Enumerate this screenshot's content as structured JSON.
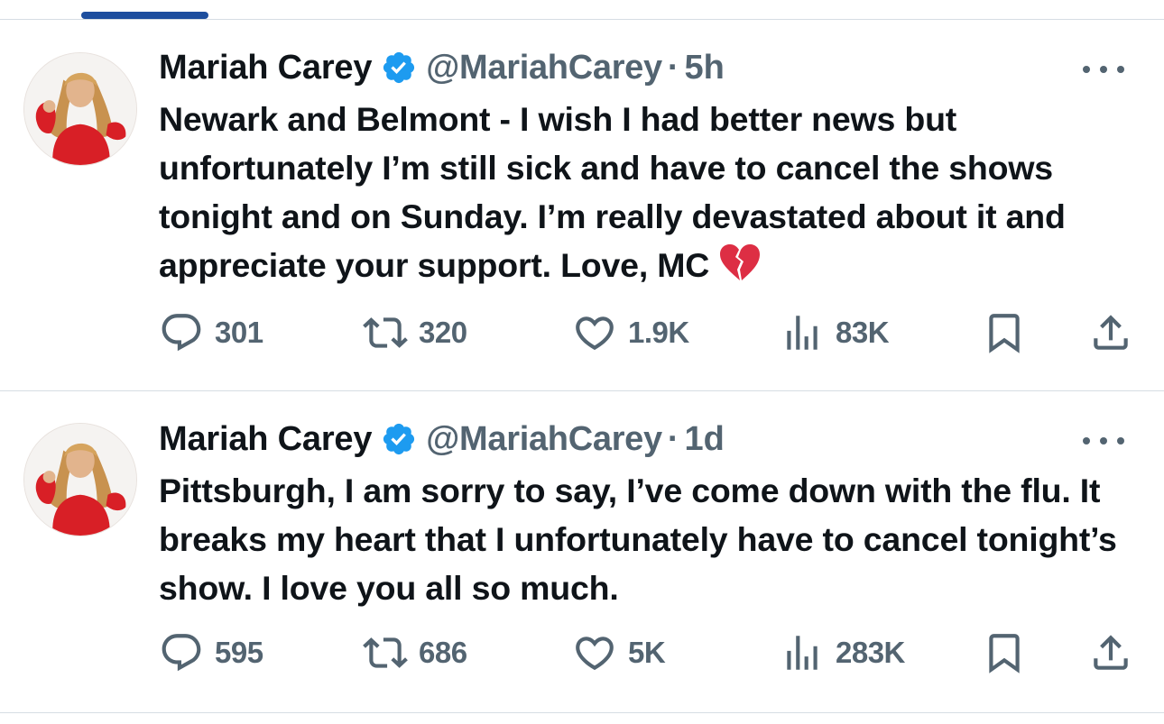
{
  "tweets": [
    {
      "display_name": "Mariah Carey",
      "handle": "@MariahCarey",
      "separator": "·",
      "time": "5h",
      "text": "Newark and Belmont - I wish I had better news but unfortunately I’m still sick and have to cancel the shows tonight and on Sunday. I’m really devastated about it and appreciate your support. Love, MC",
      "emoji": "broken-heart",
      "replies": "301",
      "reposts": "320",
      "likes": "1.9K",
      "views": "83K"
    },
    {
      "display_name": "Mariah Carey",
      "handle": "@MariahCarey",
      "separator": "·",
      "time": "1d",
      "text": "Pittsburgh, I am sorry to say, I’ve come down with the flu. It breaks my heart that I unfortunately have to cancel tonight’s show. I love you all so much.",
      "replies": "595",
      "reposts": "686",
      "likes": "5K",
      "views": "283K"
    }
  ],
  "colors": {
    "text": "#0f1419",
    "secondary": "#536471",
    "verified": "#1d9bf0",
    "divider": "#d6dde3",
    "tab_indicator": "#1d4e9e"
  },
  "icons": [
    "reply-icon",
    "repost-icon",
    "like-icon",
    "views-icon",
    "bookmark-icon",
    "share-icon",
    "more-icon",
    "verified-icon"
  ]
}
